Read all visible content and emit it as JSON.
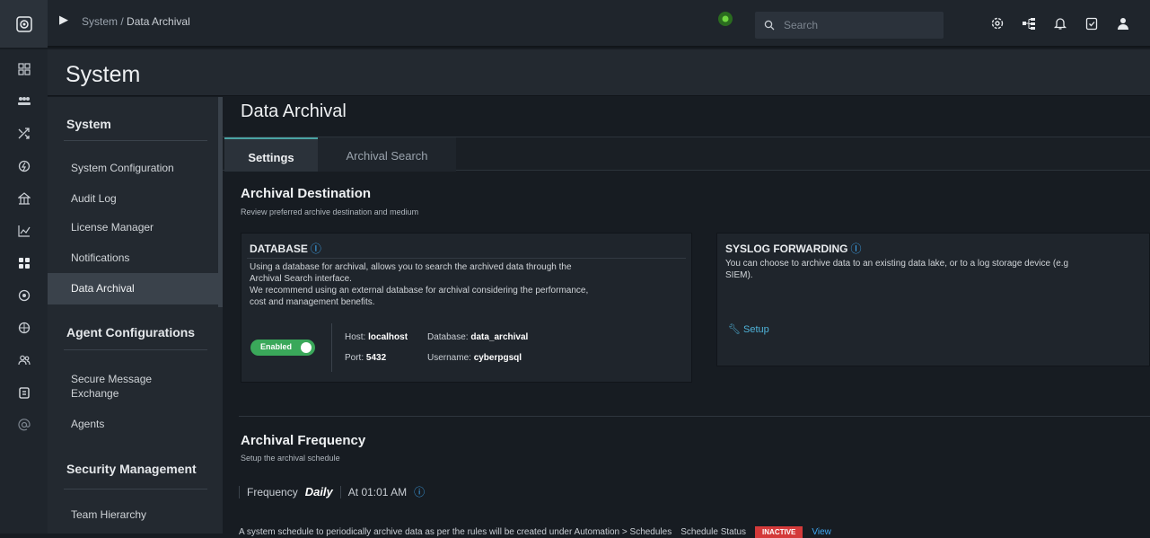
{
  "topbar": {
    "breadcrumb_root": "System /",
    "breadcrumb_current": "Data Archival",
    "search_placeholder": "Search"
  },
  "header": {
    "title": "System"
  },
  "nav": {
    "sections": [
      {
        "title": "System",
        "items": [
          "System Configuration",
          "Audit Log",
          "License Manager",
          "Notifications",
          "Data Archival"
        ]
      },
      {
        "title": "Agent Configurations",
        "items": [
          "Secure Message Exchange",
          "Agents"
        ]
      },
      {
        "title": "Security Management",
        "items": [
          "Team Hierarchy"
        ]
      }
    ],
    "active_item": "Data Archival"
  },
  "page": {
    "title": "Data Archival",
    "tabs": [
      "Settings",
      "Archival Search"
    ],
    "active_tab": "Settings"
  },
  "destination": {
    "title": "Archival Destination",
    "subtitle": "Review preferred archive destination and medium"
  },
  "database": {
    "title": "DATABASE",
    "line1": "Using a database for archival, allows you to search the archived data through the",
    "line2": "Archival Search interface.",
    "line3": "We recommend using an external database for archival considering the performance,",
    "line4": "cost and management benefits.",
    "toggle_label": "Enabled",
    "enabled": true,
    "host_label": "Host:",
    "host_value": "localhost",
    "database_label": "Database:",
    "database_value": "data_archival",
    "port_label": "Port:",
    "port_value": "5432",
    "username_label": "Username:",
    "username_value": "cyberpgsql"
  },
  "syslog": {
    "title": "SYSLOG FORWARDING",
    "line1": "You can choose to archive data to an existing data lake, or to a log storage device (e.g",
    "line2": "SIEM).",
    "setup_label": "Setup"
  },
  "frequency": {
    "title": "Archival Frequency",
    "subtitle": "Setup the archival schedule",
    "label": "Frequency",
    "value": "Daily",
    "time": "At 01:01 AM"
  },
  "schedule": {
    "text": "A system schedule to periodically archive data as per the rules will be created under Automation > Schedules",
    "status_label": "Schedule Status",
    "status_value": "INACTIVE",
    "view_label": "View"
  },
  "colors": {
    "accent": "#4aa3a3",
    "enabled": "#3aa85a",
    "inactive": "#d43a3a",
    "link": "#3fa9f5"
  }
}
